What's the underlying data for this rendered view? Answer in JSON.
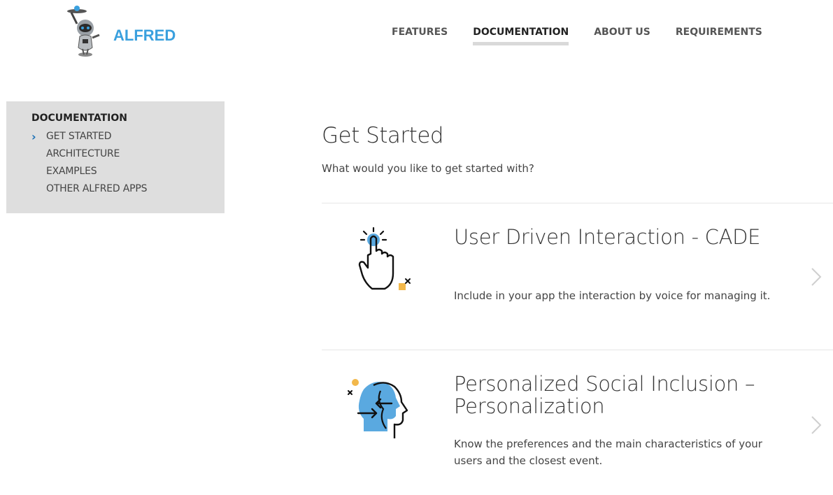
{
  "brand": {
    "name": "ALFRED"
  },
  "nav": {
    "items": [
      {
        "label": "FEATURES",
        "active": false
      },
      {
        "label": "DOCUMENTATION",
        "active": true
      },
      {
        "label": "ABOUT US",
        "active": false
      },
      {
        "label": "REQUIREMENTS",
        "active": false
      }
    ]
  },
  "sidebar": {
    "title": "DOCUMENTATION",
    "items": [
      {
        "label": "GET STARTED",
        "selected": true
      },
      {
        "label": "ARCHITECTURE",
        "selected": false
      },
      {
        "label": "EXAMPLES",
        "selected": false
      },
      {
        "label": "OTHER ALFRED APPS",
        "selected": false
      }
    ]
  },
  "main": {
    "title": "Get Started",
    "subtitle": "What would you like to get started with?",
    "cards": [
      {
        "title": "User Driven Interaction - CADE",
        "description": "Include in your app the interaction by voice for managing it.",
        "icon": "hand-pointer-icon"
      },
      {
        "title": "Personalized Social Inclusion – Personalization",
        "description": "Know the preferences and the main characteristics of your users and the closest event.",
        "icon": "head-profile-icon"
      }
    ]
  },
  "colors": {
    "brand_blue": "#3aa0de",
    "icon_blue": "#5aa9e0",
    "icon_yellow": "#f2b84b",
    "sidebar_bg": "#dedede",
    "chevron_blue": "#1a6fb5"
  }
}
